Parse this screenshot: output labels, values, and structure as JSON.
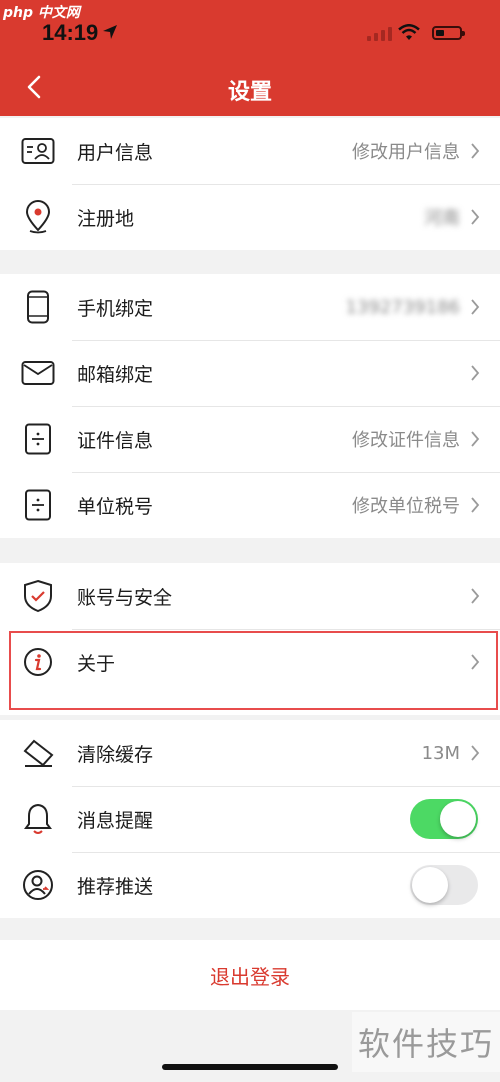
{
  "status": {
    "watermark": "php 中文网",
    "time": "14:19"
  },
  "header": {
    "title": "设置"
  },
  "group1": [
    {
      "label": "用户信息",
      "value": "修改用户信息",
      "icon": "id-card-icon"
    },
    {
      "label": "注册地",
      "value": "河南",
      "icon": "location-pin-icon"
    }
  ],
  "group2": [
    {
      "label": "手机绑定",
      "value": "1392739186",
      "icon": "phone-icon"
    },
    {
      "label": "邮箱绑定",
      "value": "",
      "icon": "mail-icon"
    },
    {
      "label": "证件信息",
      "value": "修改证件信息",
      "icon": "document-icon"
    },
    {
      "label": "单位税号",
      "value": "修改单位税号",
      "icon": "document-icon"
    }
  ],
  "group3": [
    {
      "label": "账号与安全",
      "icon": "shield-check-icon"
    },
    {
      "label": "关于",
      "icon": "info-icon"
    }
  ],
  "group4": {
    "cache": {
      "label": "清除缓存",
      "value": "13M",
      "icon": "eraser-icon"
    },
    "notify": {
      "label": "消息提醒",
      "enabled": true,
      "icon": "bell-icon"
    },
    "push": {
      "label": "推荐推送",
      "enabled": false,
      "icon": "user-circle-icon"
    }
  },
  "logout": {
    "label": "退出登录"
  },
  "footer": {
    "watermark": "软件技巧"
  },
  "colors": {
    "accent": "#d93a2f",
    "toggle_on": "#4cd964",
    "highlight": "#e84c4c"
  }
}
